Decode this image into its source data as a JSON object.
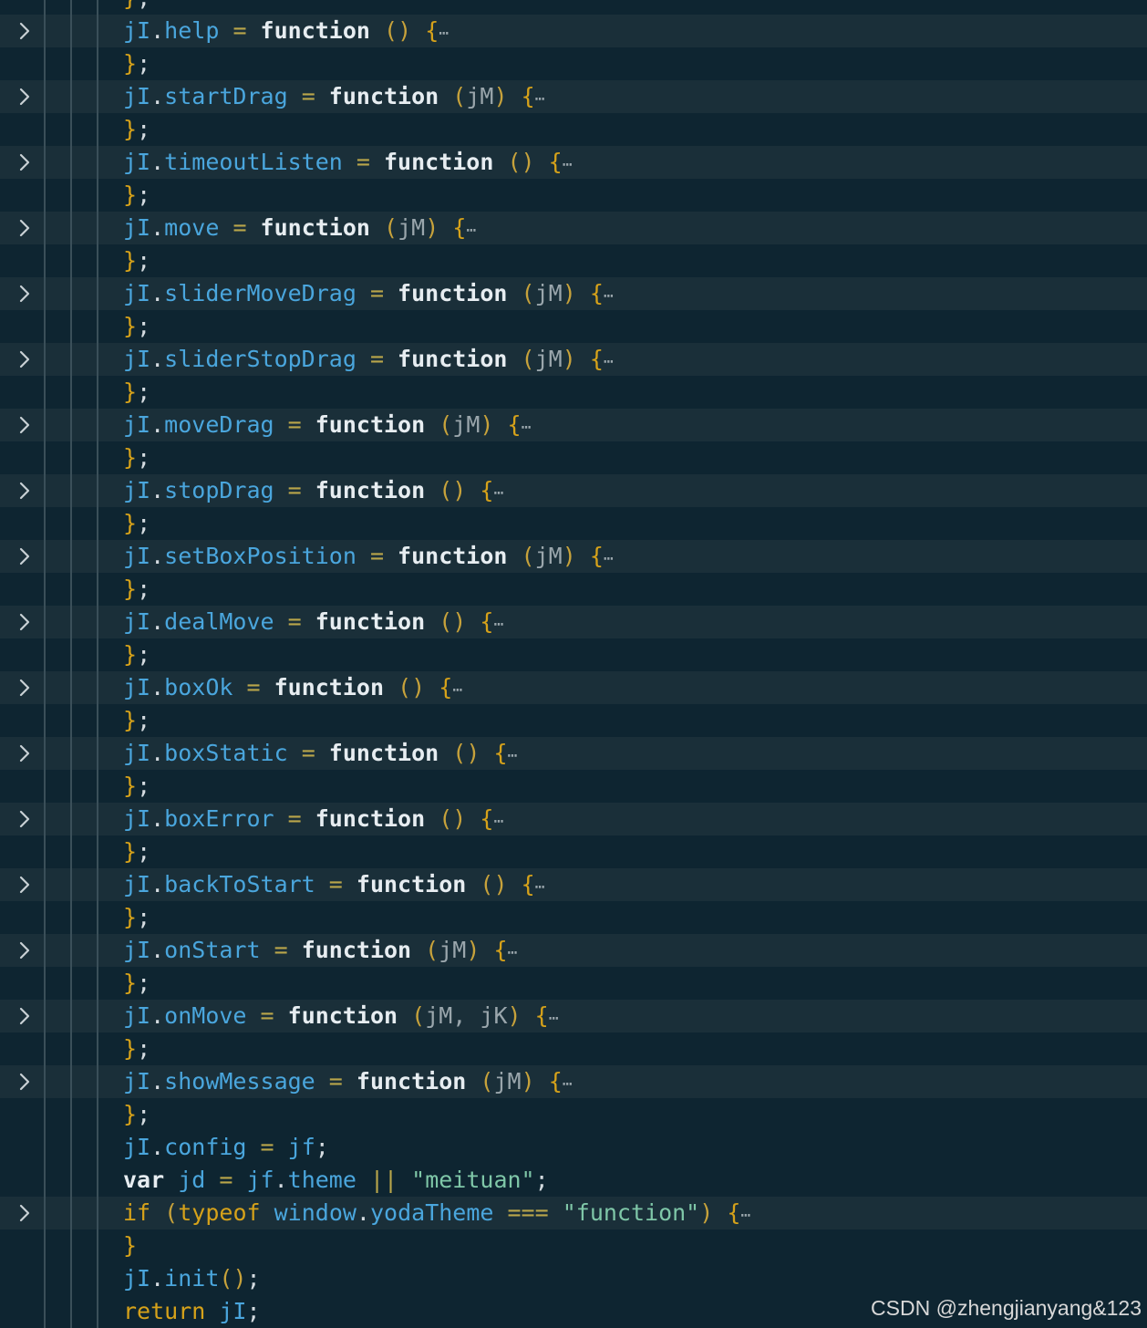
{
  "editor": {
    "language": "javascript",
    "colors": {
      "background": "#0e2531",
      "line_highlight": "#1a2f39",
      "object": "#4aa6dd",
      "keyword": "#e7edf1",
      "brace": "#d6a21a",
      "string": "#7fc7a8"
    },
    "lines": [
      {
        "kind": "close",
        "text": "};",
        "partial": true
      },
      {
        "kind": "method",
        "obj": "jI",
        "name": "help",
        "params": ""
      },
      {
        "kind": "close",
        "text": "};"
      },
      {
        "kind": "method",
        "obj": "jI",
        "name": "startDrag",
        "params": "jM"
      },
      {
        "kind": "close",
        "text": "};"
      },
      {
        "kind": "method",
        "obj": "jI",
        "name": "timeoutListen",
        "params": ""
      },
      {
        "kind": "close",
        "text": "};"
      },
      {
        "kind": "method",
        "obj": "jI",
        "name": "move",
        "params": "jM"
      },
      {
        "kind": "close",
        "text": "};"
      },
      {
        "kind": "method",
        "obj": "jI",
        "name": "sliderMoveDrag",
        "params": "jM"
      },
      {
        "kind": "close",
        "text": "};"
      },
      {
        "kind": "method",
        "obj": "jI",
        "name": "sliderStopDrag",
        "params": "jM"
      },
      {
        "kind": "close",
        "text": "};"
      },
      {
        "kind": "method",
        "obj": "jI",
        "name": "moveDrag",
        "params": "jM"
      },
      {
        "kind": "close",
        "text": "};"
      },
      {
        "kind": "method",
        "obj": "jI",
        "name": "stopDrag",
        "params": ""
      },
      {
        "kind": "close",
        "text": "};"
      },
      {
        "kind": "method",
        "obj": "jI",
        "name": "setBoxPosition",
        "params": "jM"
      },
      {
        "kind": "close",
        "text": "};"
      },
      {
        "kind": "method",
        "obj": "jI",
        "name": "dealMove",
        "params": ""
      },
      {
        "kind": "close",
        "text": "};"
      },
      {
        "kind": "method",
        "obj": "jI",
        "name": "boxOk",
        "params": ""
      },
      {
        "kind": "close",
        "text": "};"
      },
      {
        "kind": "method",
        "obj": "jI",
        "name": "boxStatic",
        "params": ""
      },
      {
        "kind": "close",
        "text": "};"
      },
      {
        "kind": "method",
        "obj": "jI",
        "name": "boxError",
        "params": ""
      },
      {
        "kind": "close",
        "text": "};"
      },
      {
        "kind": "method",
        "obj": "jI",
        "name": "backToStart",
        "params": ""
      },
      {
        "kind": "close",
        "text": "};"
      },
      {
        "kind": "method",
        "obj": "jI",
        "name": "onStart",
        "params": "jM"
      },
      {
        "kind": "close",
        "text": "};"
      },
      {
        "kind": "method",
        "obj": "jI",
        "name": "onMove",
        "params": "jM, jK"
      },
      {
        "kind": "close",
        "text": "};"
      },
      {
        "kind": "method",
        "obj": "jI",
        "name": "showMessage",
        "params": "jM"
      },
      {
        "kind": "close",
        "text": "};"
      },
      {
        "kind": "assign",
        "obj": "jI",
        "name": "config",
        "value": "jf"
      },
      {
        "kind": "var",
        "keyword": "var",
        "name": "jd",
        "obj": "jf",
        "prop": "theme",
        "op": "||",
        "str": "\"meituan\""
      },
      {
        "kind": "if",
        "keyword": "if",
        "typeof": "typeof",
        "obj": "window",
        "prop": "yodaTheme",
        "op": "===",
        "str": "\"function\""
      },
      {
        "kind": "brace",
        "text": "}"
      },
      {
        "kind": "call",
        "obj": "jI",
        "name": "init"
      },
      {
        "kind": "return",
        "keyword": "return",
        "obj": "jI"
      }
    ],
    "fold_indicator_icon": "chevron-right-icon",
    "collapsed_ellipsis": "⋯",
    "function_keyword": "function"
  },
  "watermark": "CSDN @zhengjianyang&123"
}
